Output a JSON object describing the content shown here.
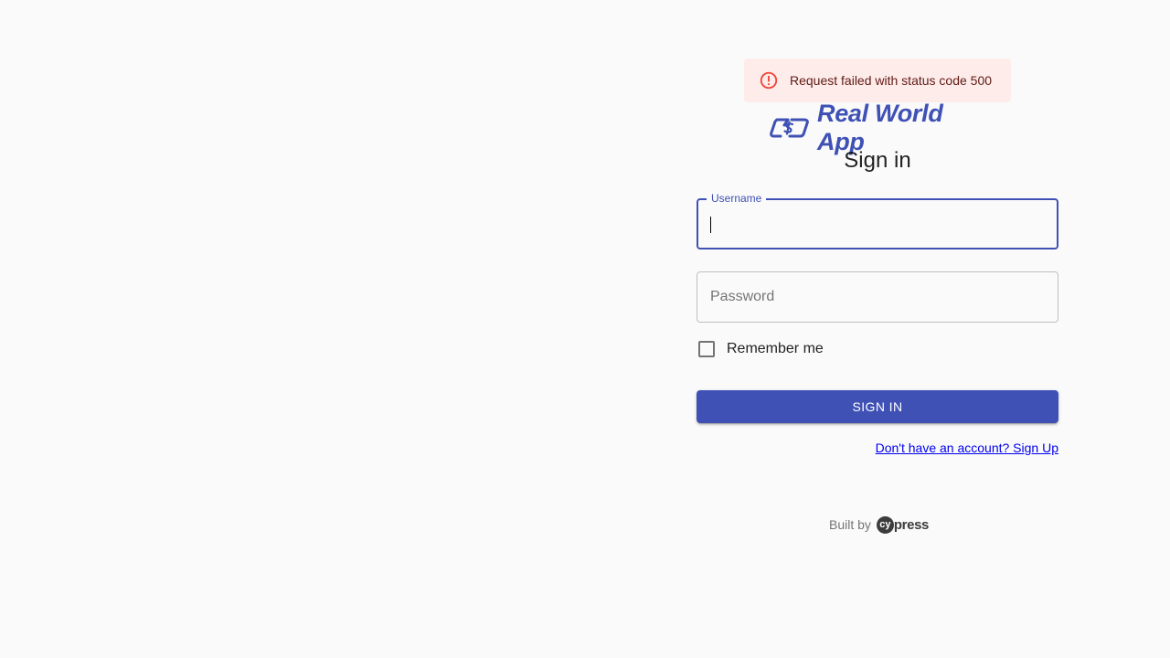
{
  "alert": {
    "message": "Request failed with status code 500",
    "icon": "error-outline-icon",
    "color": "#f44336"
  },
  "brand": {
    "name": "Real World App",
    "logo_icon": "real-world-app-logo-icon",
    "color": "#3f51b5"
  },
  "form": {
    "title": "Sign in",
    "username_label": "Username",
    "username_value": "",
    "password_placeholder": "Password",
    "remember_label": "Remember me",
    "remember_checked": false,
    "submit_label": "Sign In",
    "signup_link": "Don't have an account? Sign Up"
  },
  "footer": {
    "built_by": "Built by",
    "cypress_logo_text": "press",
    "cypress_logo_mark": "cy"
  }
}
